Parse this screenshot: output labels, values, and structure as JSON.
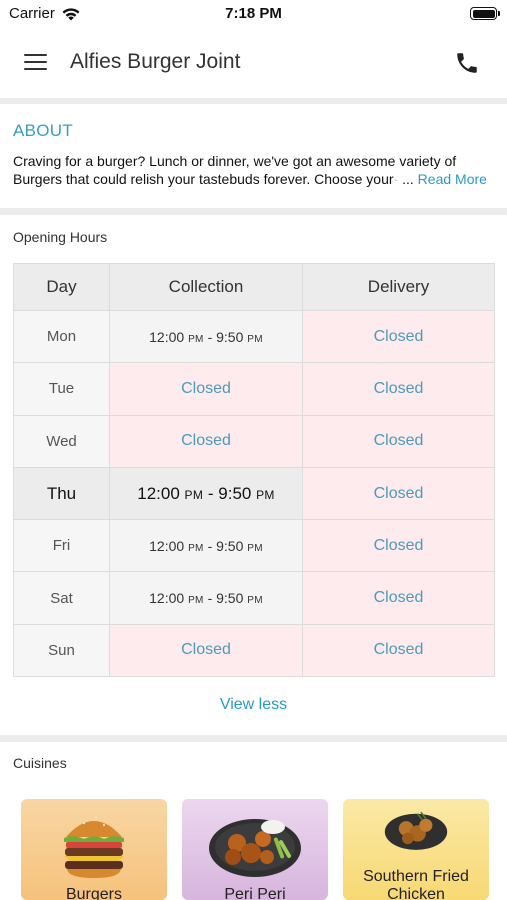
{
  "status_bar": {
    "carrier": "Carrier",
    "time": "7:18 PM"
  },
  "header": {
    "title": "Alfies Burger Joint",
    "menu_icon": "hamburger-menu-icon",
    "call_icon": "phone-icon"
  },
  "about": {
    "heading": "ABOUT",
    "text": "Craving for a burger? Lunch or dinner, we've got an awesome variety of Burgers that could relish your tastebuds forever. Choose your",
    "ellipsis": "...",
    "read_more": "Read More"
  },
  "opening_hours": {
    "label": "Opening Hours",
    "columns": [
      "Day",
      "Collection",
      "Delivery"
    ],
    "rows": [
      {
        "day": "Mon",
        "collection": {
          "open": "12:00",
          "open_suffix": "PM",
          "sep": "-",
          "close": "9:50",
          "close_suffix": "PM"
        },
        "delivery": "Closed"
      },
      {
        "day": "Tue",
        "collection": "Closed",
        "delivery": "Closed"
      },
      {
        "day": "Wed",
        "collection": "Closed",
        "delivery": "Closed"
      },
      {
        "day": "Thu",
        "collection": {
          "open": "12:00",
          "open_suffix": "PM",
          "sep": "-",
          "close": "9:50",
          "close_suffix": "PM"
        },
        "delivery": "Closed"
      },
      {
        "day": "Fri",
        "collection": {
          "open": "12:00",
          "open_suffix": "PM",
          "sep": "-",
          "close": "9:50",
          "close_suffix": "PM"
        },
        "delivery": "Closed"
      },
      {
        "day": "Sat",
        "collection": {
          "open": "12:00",
          "open_suffix": "PM",
          "sep": "-",
          "close": "9:50",
          "close_suffix": "PM"
        },
        "delivery": "Closed"
      },
      {
        "day": "Sun",
        "collection": "Closed",
        "delivery": "Closed"
      }
    ],
    "view_less": "View less"
  },
  "cuisines": {
    "label": "Cuisines",
    "items": [
      {
        "name": "Burgers",
        "icon": "burger-icon"
      },
      {
        "name": "Peri Peri",
        "icon": "peri-peri-wings-icon"
      },
      {
        "name": "Southern Fried Chicken",
        "icon": "fried-chicken-icon"
      }
    ]
  },
  "colors": {
    "accent": "#2a9ac6",
    "closed_bg": "#fdebed",
    "header_bg": "#ececec"
  }
}
